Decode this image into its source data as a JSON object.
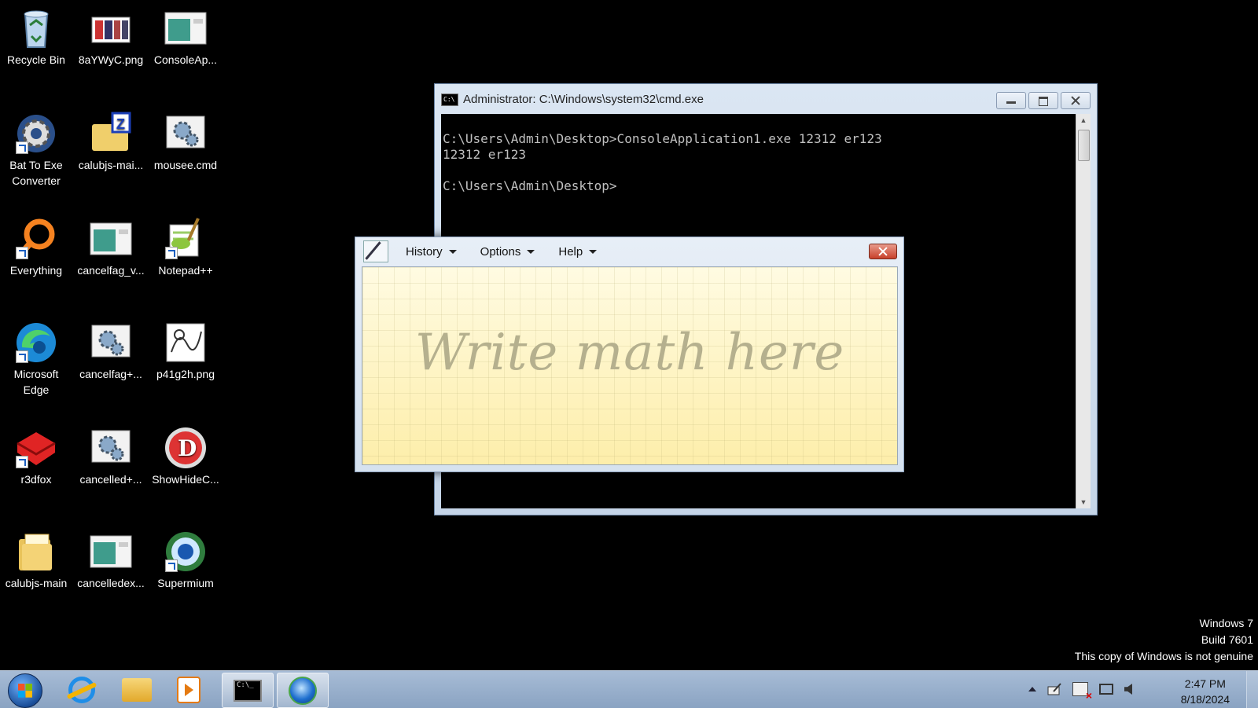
{
  "desktop": {
    "icons": [
      {
        "label": "Recycle Bin",
        "icon": "recycle-bin-icon"
      },
      {
        "label": "8aYWyC.png",
        "icon": "image-file-icon"
      },
      {
        "label": "ConsoleAp...",
        "icon": "application-icon"
      },
      {
        "label": "Bat To Exe Converter",
        "icon": "gear-icon"
      },
      {
        "label": "calubjs-mai...",
        "icon": "zip-folder-icon"
      },
      {
        "label": "mousee.cmd",
        "icon": "cmd-script-icon"
      },
      {
        "label": "Everything",
        "icon": "search-magnifier-icon"
      },
      {
        "label": "cancelfag_v...",
        "icon": "application-icon"
      },
      {
        "label": "Notepad++",
        "icon": "notepadpp-icon"
      },
      {
        "label": "Microsoft Edge",
        "icon": "edge-icon"
      },
      {
        "label": "cancelfag+...",
        "icon": "cmd-script-icon"
      },
      {
        "label": "p41g2h.png",
        "icon": "image-file-icon"
      },
      {
        "label": "r3dfox",
        "icon": "r3dfox-icon"
      },
      {
        "label": "cancelled+...",
        "icon": "cmd-script-icon"
      },
      {
        "label": "ShowHideC...",
        "icon": "showhide-icon"
      },
      {
        "label": "calubjs-main",
        "icon": "folder-icon"
      },
      {
        "label": "cancelledex...",
        "icon": "application-icon"
      },
      {
        "label": "Supermium",
        "icon": "supermium-icon"
      }
    ]
  },
  "cmd_window": {
    "title": "Administrator: C:\\Windows\\system32\\cmd.exe",
    "icon_text": "C:\\",
    "lines": [
      "C:\\Users\\Admin\\Desktop>ConsoleApplication1.exe 12312 er123",
      "12312 er123",
      "",
      "C:\\Users\\Admin\\Desktop>"
    ]
  },
  "math_panel": {
    "menus": [
      "History",
      "Options",
      "Help"
    ],
    "hint": "Write math here"
  },
  "watermark": {
    "line1": "Windows 7",
    "line2": "Build 7601",
    "line3": "This copy of Windows is not genuine"
  },
  "taskbar": {
    "clock_time": "2:47 PM",
    "clock_date": "8/18/2024",
    "cmd_icon_text": "C:\\_"
  }
}
